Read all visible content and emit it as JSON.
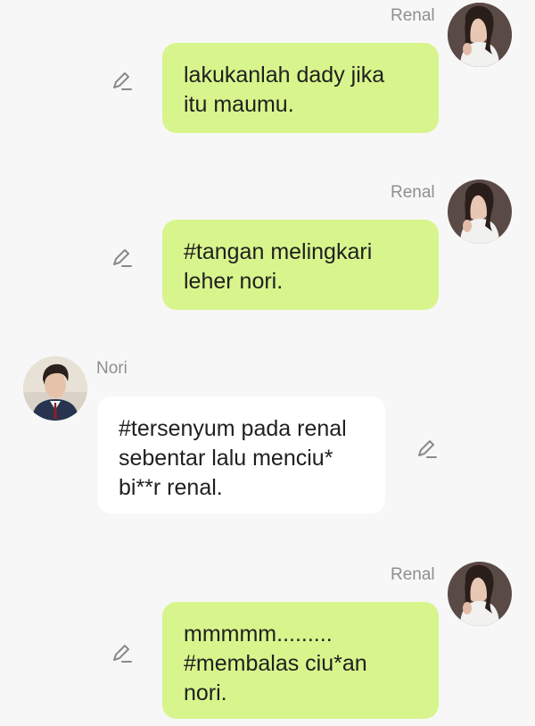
{
  "messages": [
    {
      "sender": "Renal",
      "text": "lakukanlah dady jika\nitu maumu.",
      "direction": "outgoing"
    },
    {
      "sender": "Renal",
      "text": "#tangan melingkari\nleher nori.",
      "direction": "outgoing"
    },
    {
      "sender": "Nori",
      "text": "#tersenyum pada renal\nsebentar lalu menciu*\nbi**r renal.",
      "direction": "incoming"
    },
    {
      "sender": "Renal",
      "text": "mmmmm.........\n#membalas ciu*an\nnori.",
      "direction": "outgoing"
    }
  ],
  "icons": {
    "edit": "pencil-edit-icon",
    "avatar_renal": "avatar-renal",
    "avatar_nori": "avatar-nori"
  },
  "colors": {
    "background": "#f7f7f7",
    "outgoing_bubble": "#d7f58c",
    "incoming_bubble": "#ffffff",
    "sender_name": "#8f8f8f",
    "message_text": "#202020",
    "edit_icon": "#8a8a8a"
  }
}
